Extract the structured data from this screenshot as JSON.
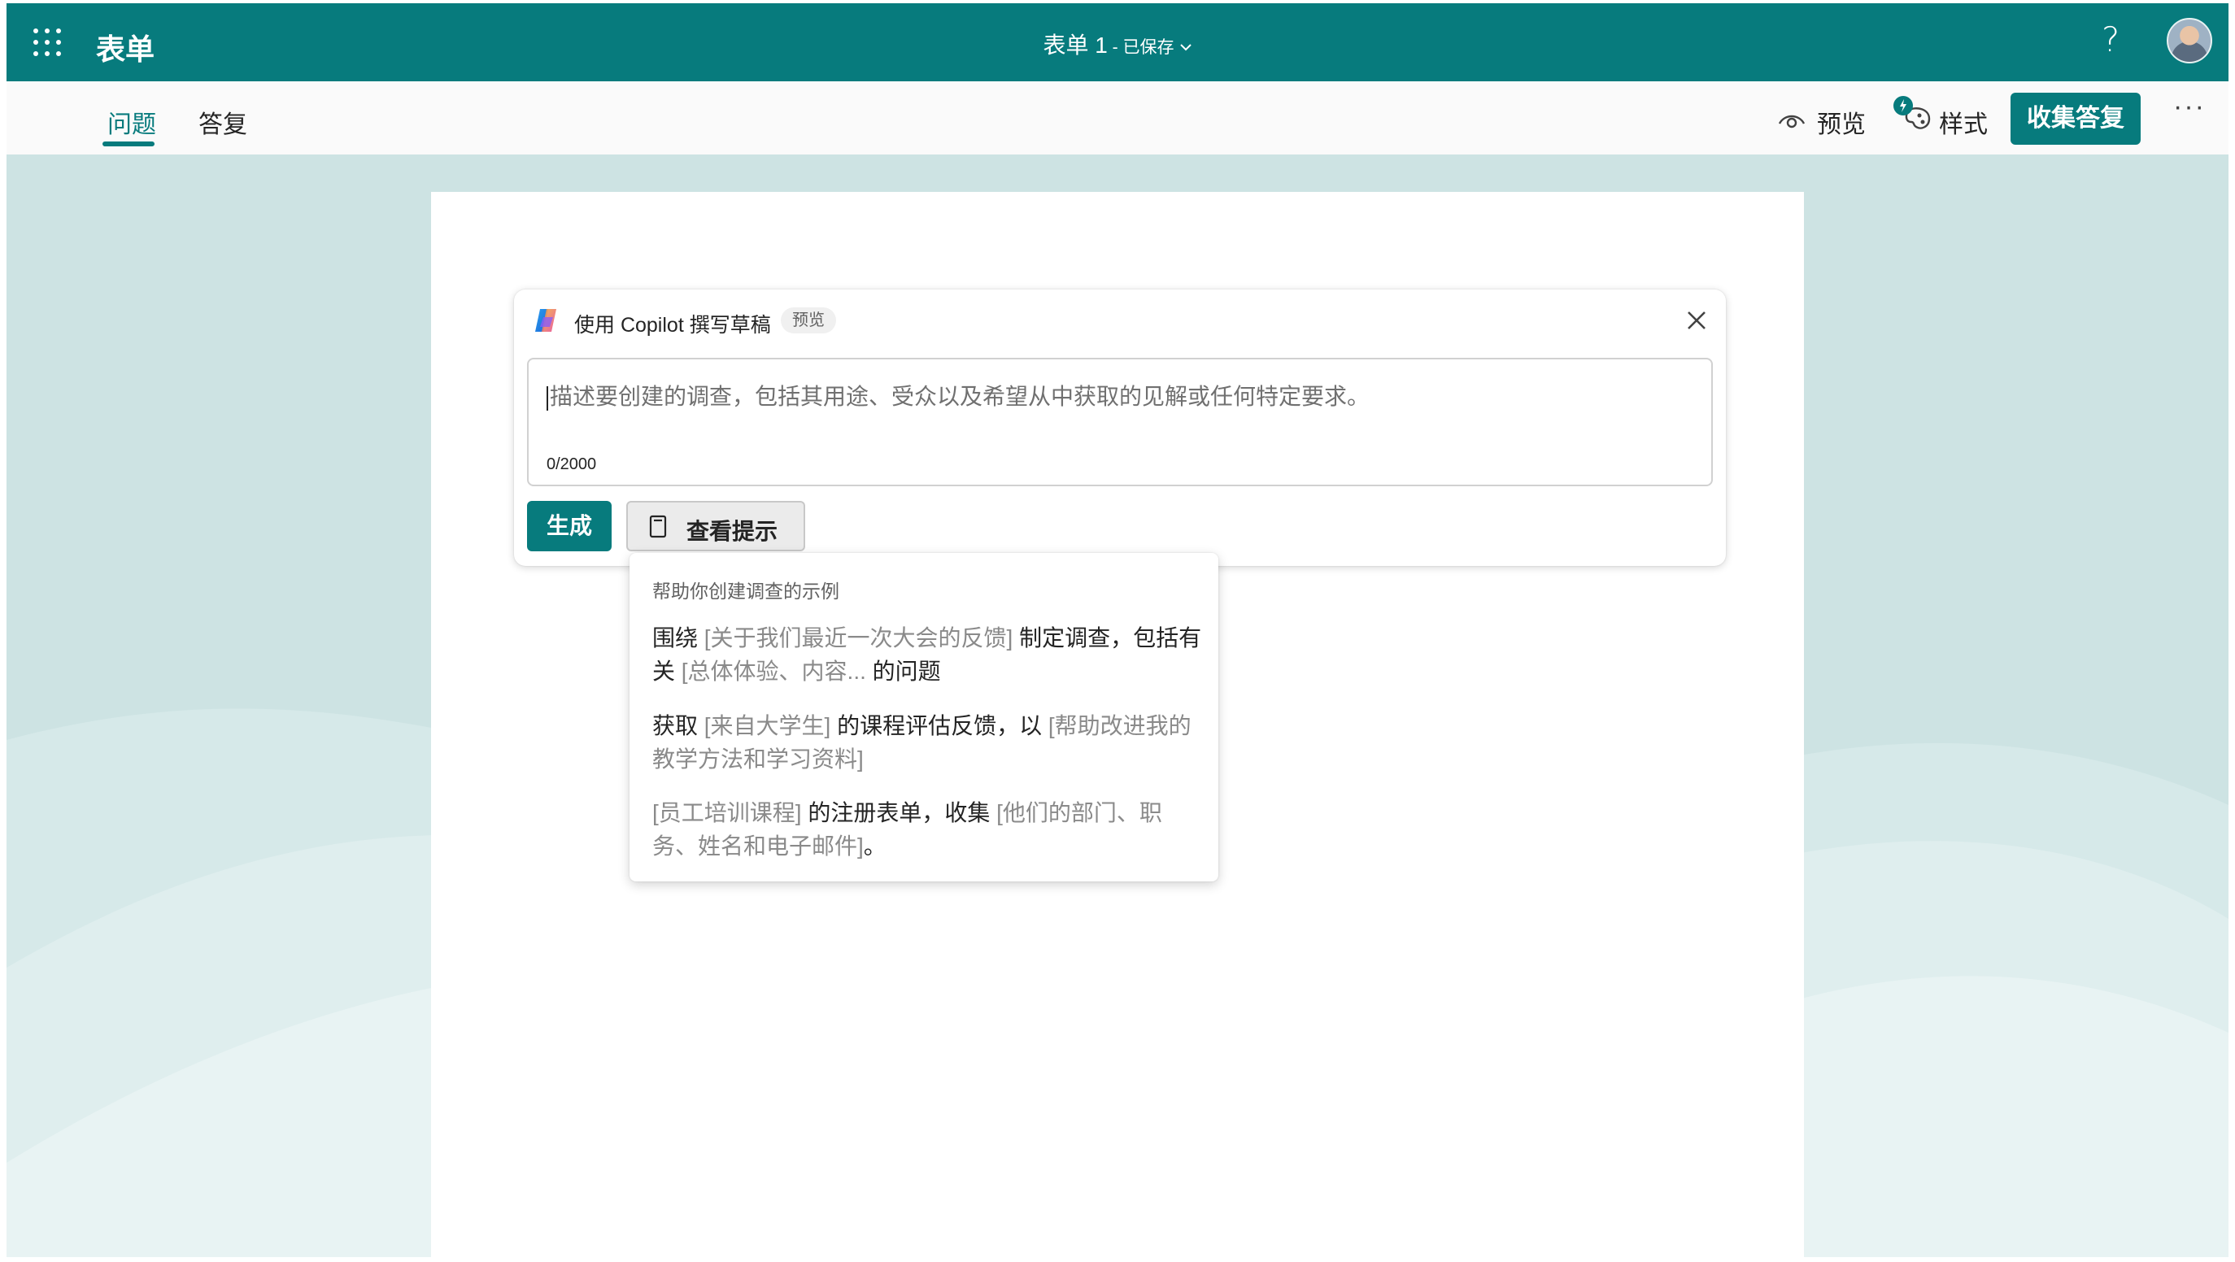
{
  "app": {
    "name": "表单"
  },
  "document": {
    "title": "表单 1",
    "separator": " - ",
    "status": "已保存"
  },
  "header": {
    "help_symbol": "?"
  },
  "tabs": [
    {
      "label": "问题",
      "active": true
    },
    {
      "label": "答复",
      "active": false
    }
  ],
  "commands": {
    "preview_label": "预览",
    "style_label": "样式",
    "collect_label": "收集答复",
    "more_symbol": "···"
  },
  "copilot": {
    "title": "使用 Copilot 撰写草稿",
    "badge": "预览",
    "placeholder": "描述要创建的调查，包括其用途、受众以及希望从中获取的见解或任何特定要求。",
    "char_count": "0/2000",
    "generate_label": "生成",
    "view_tips_label": "查看提示"
  },
  "tips": {
    "heading": "帮助你创建调查的示例",
    "examples": [
      {
        "parts": [
          {
            "text": "围绕 ",
            "placeholder": false
          },
          {
            "text": "[关于我们最近一次大会的反馈]",
            "placeholder": true
          },
          {
            "text": " 制定调查，包括有关 ",
            "placeholder": false
          },
          {
            "text": "[总体体验、内容...",
            "placeholder": true
          },
          {
            "text": " 的问题",
            "placeholder": false
          }
        ]
      },
      {
        "parts": [
          {
            "text": "获取 ",
            "placeholder": false
          },
          {
            "text": "[来自大学生]",
            "placeholder": true
          },
          {
            "text": " 的课程评估反馈，以 ",
            "placeholder": false
          },
          {
            "text": "[帮助改进我的教学方法和学习资料]",
            "placeholder": true
          }
        ]
      },
      {
        "parts": [
          {
            "text": "[员工培训课程]",
            "placeholder": true
          },
          {
            "text": " 的注册表单，收集 ",
            "placeholder": false
          },
          {
            "text": "[他们的部门、职务、姓名和电子邮件]",
            "placeholder": true
          },
          {
            "text": "。",
            "placeholder": false
          }
        ]
      }
    ]
  },
  "colors": {
    "brand": "#077b7d",
    "canvas": "#cde3e3",
    "placeholder_text": "#8a8a8a"
  },
  "icons": [
    "waffle-icon",
    "help-icon",
    "eye-icon",
    "palette-icon",
    "close-icon",
    "copilot-logo-icon",
    "clipboard-icon",
    "chevron-down-icon"
  ]
}
